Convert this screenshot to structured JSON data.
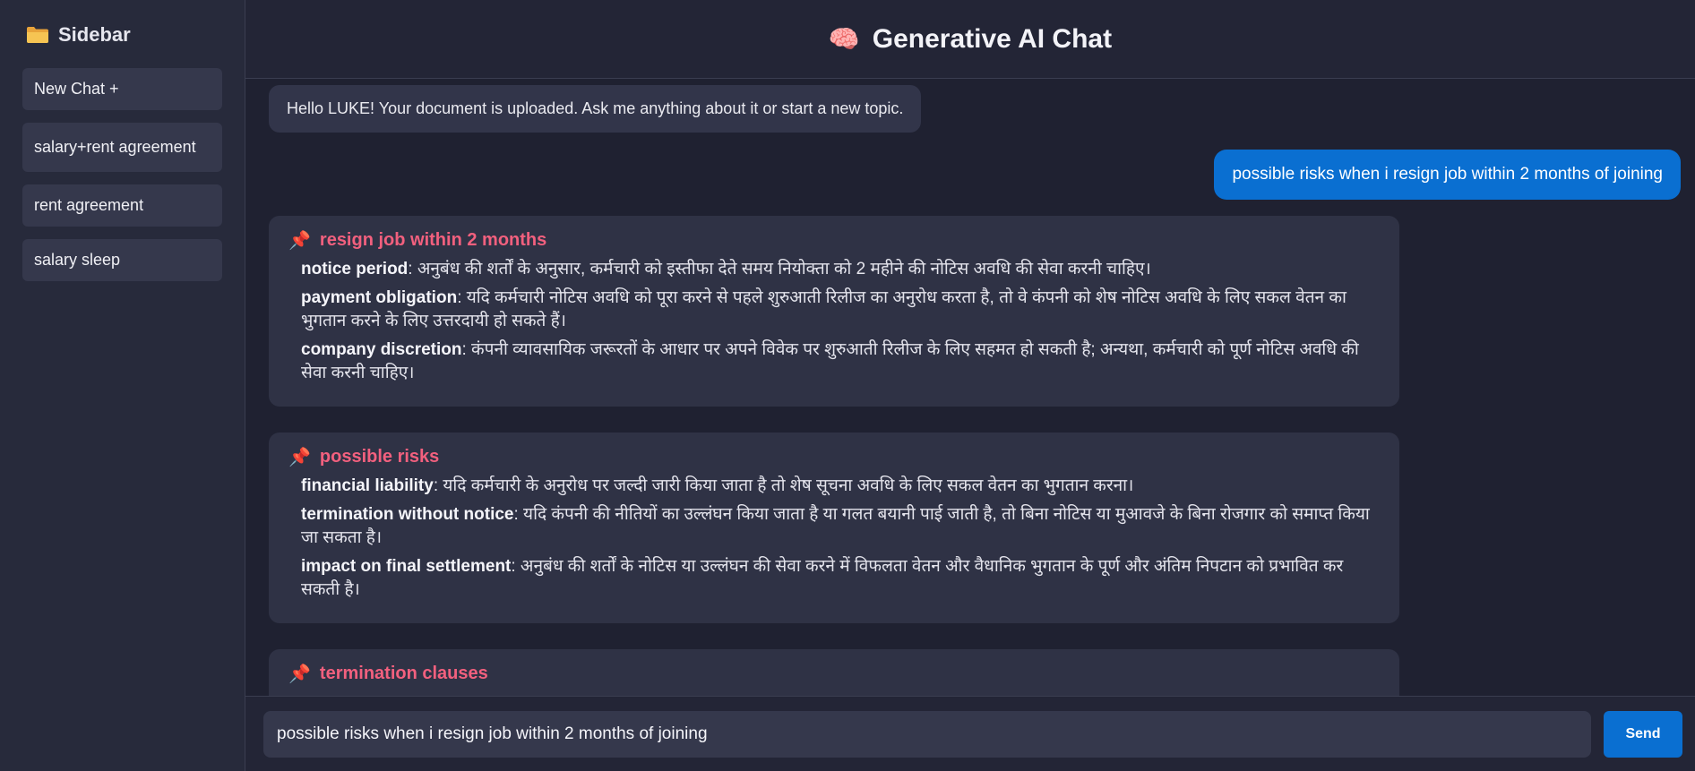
{
  "sidebar": {
    "title": "Sidebar",
    "items": [
      {
        "label": "New Chat +"
      },
      {
        "label": "salary+rent agreement"
      },
      {
        "label": "rent agreement"
      },
      {
        "label": "salary sleep"
      }
    ]
  },
  "header": {
    "icon": "🧠",
    "title": "Generative AI Chat"
  },
  "chat": {
    "greeting": "Hello LUKE! Your document is uploaded. Ask me anything about it or start a new topic.",
    "user_message": "possible risks when i resign job within 2 months of joining",
    "cards": [
      {
        "heading": "resign job within 2 months",
        "lines": [
          {
            "term": "notice period",
            "text": ": अनुबंध की शर्तों के अनुसार, कर्मचारी को इस्तीफा देते समय नियोक्ता को 2 महीने की नोटिस अवधि की सेवा करनी चाहिए।"
          },
          {
            "term": "payment obligation",
            "text": ": यदि कर्मचारी नोटिस अवधि को पूरा करने से पहले शुरुआती रिलीज का अनुरोध करता है, तो वे कंपनी को शेष नोटिस अवधि के लिए सकल वेतन का भुगतान करने के लिए उत्तरदायी हो सकते हैं।"
          },
          {
            "term": "company discretion",
            "text": ": कंपनी व्यावसायिक जरूरतों के आधार पर अपने विवेक पर शुरुआती रिलीज के लिए सहमत हो सकती है; अन्यथा, कर्मचारी को पूर्ण नोटिस अवधि की सेवा करनी चाहिए।"
          }
        ]
      },
      {
        "heading": "possible risks",
        "lines": [
          {
            "term": "financial liability",
            "text": ": यदि कर्मचारी के अनुरोध पर जल्दी जारी किया जाता है तो शेष सूचना अवधि के लिए सकल वेतन का भुगतान करना।"
          },
          {
            "term": "termination without notice",
            "text": ": यदि कंपनी की नीतियों का उल्लंघन किया जाता है या गलत बयानी पाई जाती है, तो बिना नोटिस या मुआवजे के बिना रोजगार को समाप्त किया जा सकता है।"
          },
          {
            "term": "impact on final settlement",
            "text": ": अनुबंध की शर्तों के नोटिस या उल्लंघन की सेवा करने में विफलता वेतन और वैधानिक भुगतान के पूर्ण और अंतिम निपटान को प्रभावित कर सकती है।"
          }
        ]
      },
      {
        "heading": "termination clauses",
        "lines": []
      }
    ]
  },
  "input": {
    "value": "possible risks when i resign job within 2 months of joining",
    "send_label": "Send"
  },
  "icons": {
    "folder": "folder-icon",
    "brain": "brain-icon",
    "pin": "pushpin-icon"
  },
  "colors": {
    "accent": "#0a6fd1",
    "heading": "#f2607e",
    "background": "#1f2131",
    "card": "#2f3245"
  }
}
